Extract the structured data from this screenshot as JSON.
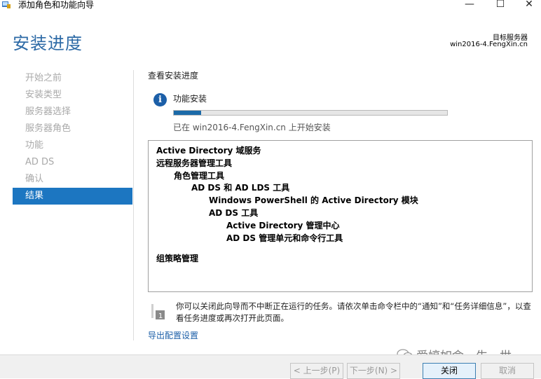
{
  "window": {
    "title": "添加角色和功能向导",
    "minimize": "—",
    "maximize": "☐",
    "close": "✕"
  },
  "header": {
    "title": "安装进度",
    "target_label": "目标服务器",
    "target_value": "win2016-4.FengXin.cn"
  },
  "nav": {
    "items": [
      {
        "label": "开始之前",
        "active": false
      },
      {
        "label": "安装类型",
        "active": false
      },
      {
        "label": "服务器选择",
        "active": false
      },
      {
        "label": "服务器角色",
        "active": false
      },
      {
        "label": "功能",
        "active": false
      },
      {
        "label": "AD DS",
        "active": false
      },
      {
        "label": "确认",
        "active": false
      },
      {
        "label": "结果",
        "active": true
      }
    ]
  },
  "main": {
    "heading": "查看安装进度",
    "feature_install": "功能安装",
    "progress_fraction": 0.1,
    "status": "已在 win2016-4.FengXin.cn 上开始安装",
    "results": [
      {
        "text": "Active Directory 域服务",
        "level": 0
      },
      {
        "text": "远程服务器管理工具",
        "level": 0
      },
      {
        "text": "角色管理工具",
        "level": 1
      },
      {
        "text": "AD DS 和 AD LDS 工具",
        "level": 2
      },
      {
        "text": "Windows PowerShell 的 Active Directory 模块",
        "level": 3
      },
      {
        "text": "AD DS 工具",
        "level": 3
      },
      {
        "text": "Active Directory 管理中心",
        "level": 4
      },
      {
        "text": "AD DS 管理单元和命令行工具",
        "level": 4
      },
      {
        "text": "组策略管理",
        "level": 0
      }
    ],
    "notice": "你可以关闭此向导而不中断正在运行的任务。请依次单击命令栏中的“通知”和“任务详细信息”，以查看任务进度或再次打开此页面。",
    "export_link": "导出配置设置"
  },
  "watermark": "爱婷如命一生一世",
  "buttons": {
    "prev": "< 上一步(P)",
    "next": "下一步(N) >",
    "close": "关闭",
    "cancel": "取消"
  },
  "colors": {
    "accent": "#1c76c1",
    "header_title": "#2d6aa6",
    "nav_disabled": "#a9a9a9"
  }
}
